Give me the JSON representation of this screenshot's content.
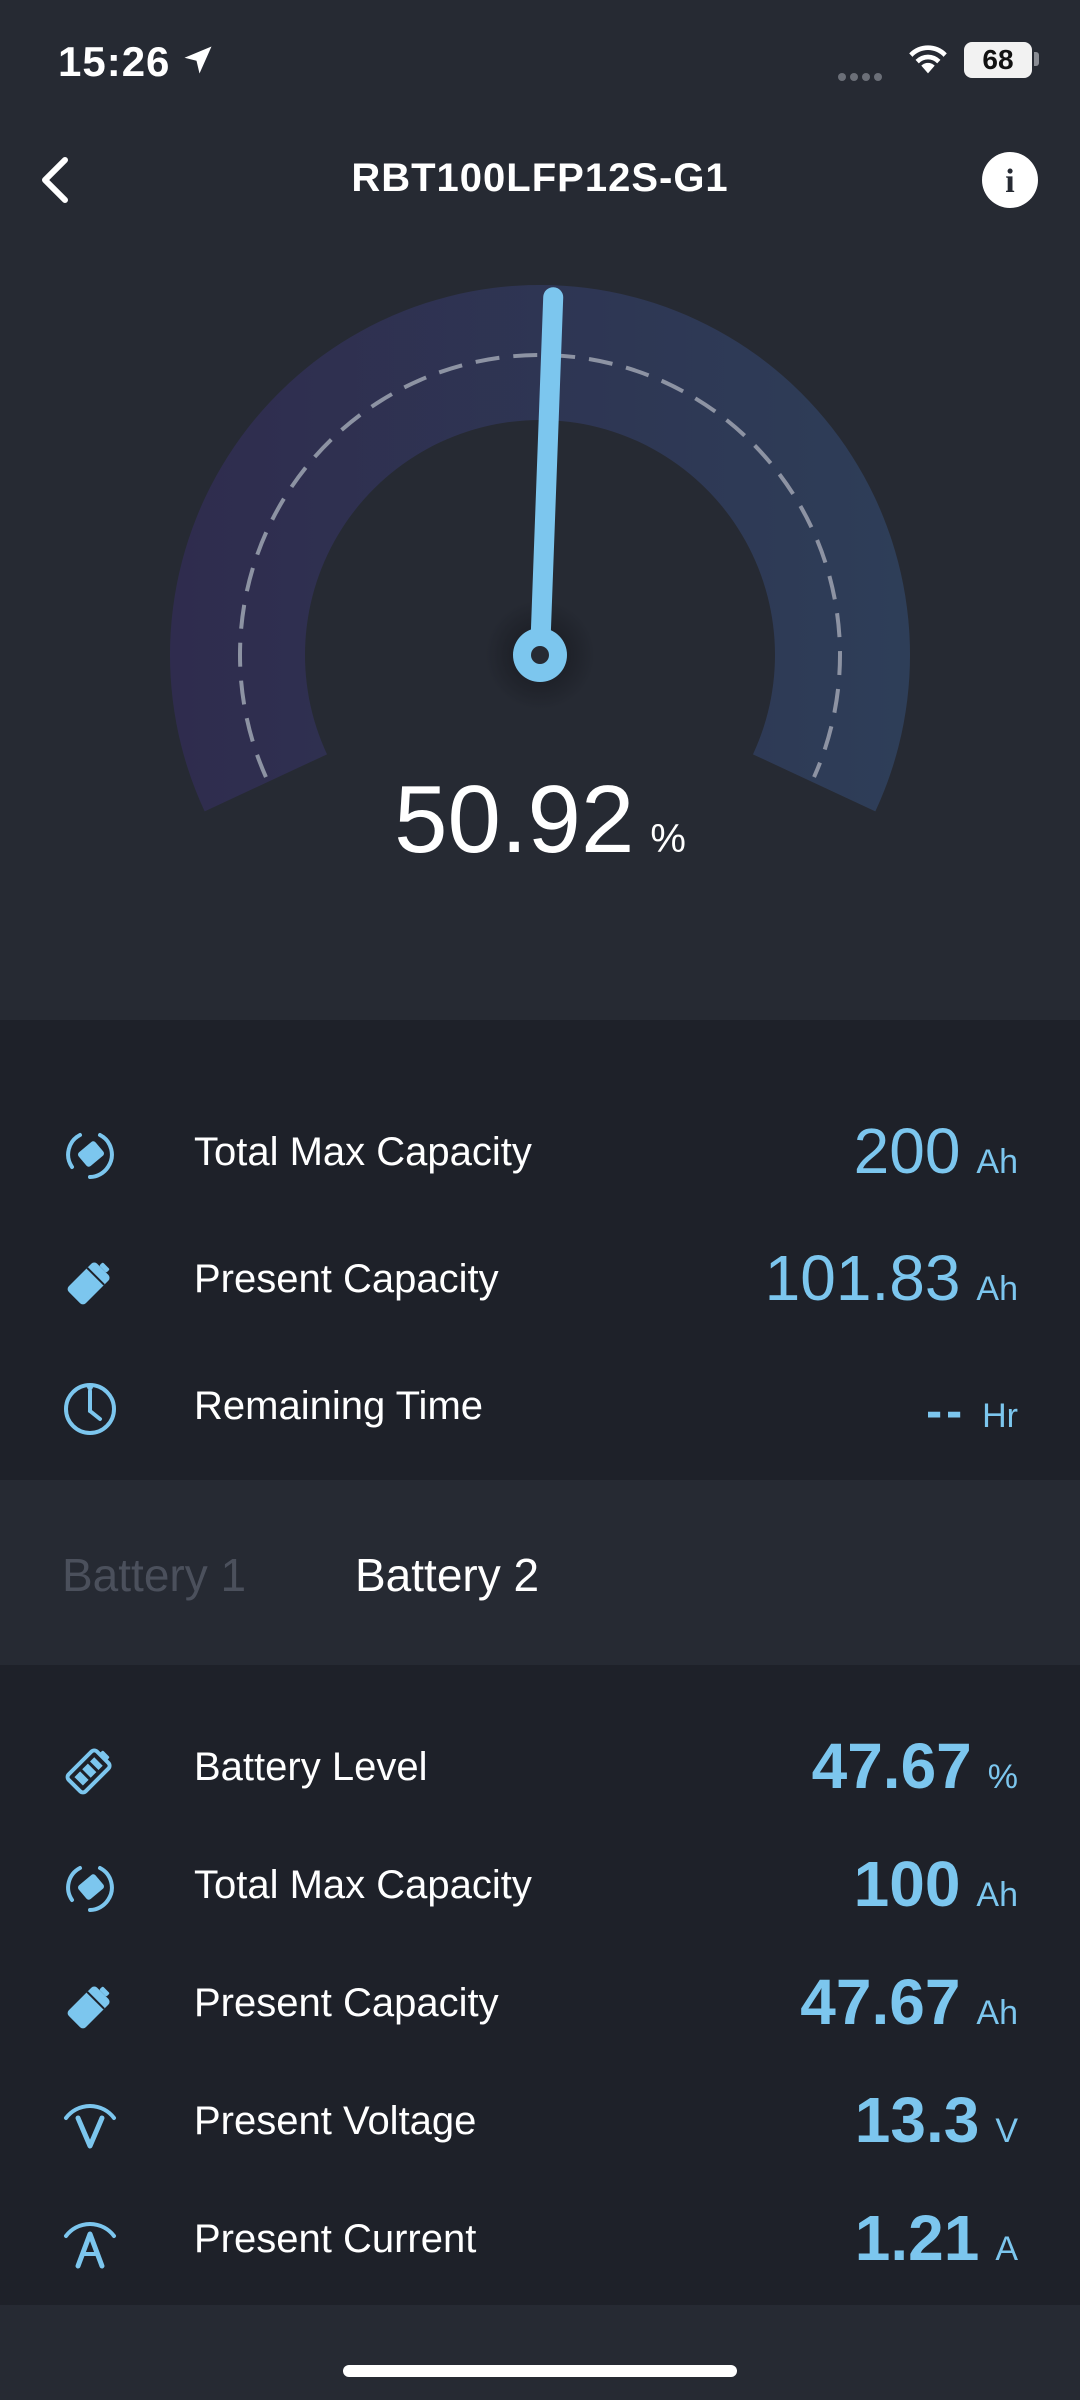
{
  "status_bar": {
    "time": "15:26",
    "battery": "68",
    "icons": [
      "location-arrow-icon",
      "cell-signal-icon",
      "wifi-icon",
      "battery-icon"
    ]
  },
  "nav": {
    "title": "RBT100LFP12S-G1",
    "back_icon": "chevron-left-icon",
    "info_icon": "info-icon",
    "info_glyph": "i"
  },
  "gauge": {
    "value": "50.92",
    "unit": "%",
    "percent": 50.92,
    "colors": {
      "arc_start": "#2f2c4e",
      "arc_end": "#2e3e58",
      "needle": "#7cc6ee",
      "dash": "#8d93a3"
    }
  },
  "summary": {
    "rows": [
      {
        "label": "Total Max Capacity",
        "value": "200",
        "unit": "Ah",
        "icon": "capacity-cycle-icon"
      },
      {
        "label": "Present Capacity",
        "value": "101.83",
        "unit": "Ah",
        "icon": "battery-tilted-icon"
      },
      {
        "label": "Remaining Time",
        "value": "--",
        "unit": "Hr",
        "icon": "clock-icon"
      }
    ]
  },
  "tabs": [
    {
      "label": "Battery 1",
      "active": false
    },
    {
      "label": "Battery 2",
      "active": true
    }
  ],
  "detail": {
    "rows": [
      {
        "label": "Battery Level",
        "value": "47.67",
        "unit": "%",
        "icon": "battery-level-icon"
      },
      {
        "label": "Total Max Capacity",
        "value": "100",
        "unit": "Ah",
        "icon": "capacity-cycle-icon"
      },
      {
        "label": "Present Capacity",
        "value": "47.67",
        "unit": "Ah",
        "icon": "battery-tilted-icon"
      },
      {
        "label": "Present Voltage",
        "value": "13.3",
        "unit": "V",
        "icon": "voltage-icon"
      },
      {
        "label": "Present Current",
        "value": "1.21",
        "unit": "A",
        "icon": "current-icon"
      }
    ]
  },
  "theme": {
    "background": "#262a33",
    "panel": "#1e2129",
    "accent": "#7cc6ee",
    "tab_inactive": "#4b505c"
  }
}
